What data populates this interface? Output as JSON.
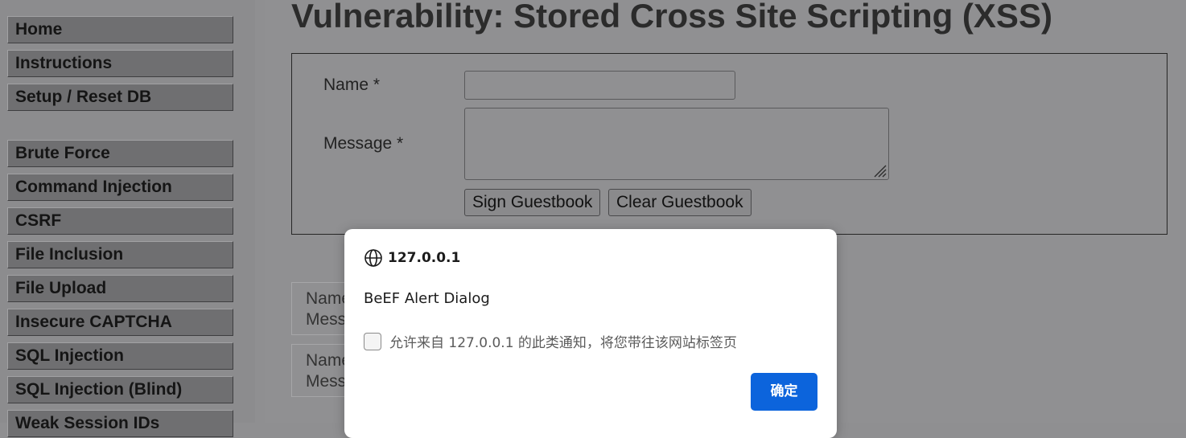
{
  "colors": {
    "backdrop": "#8f8f91",
    "menu_item_bg": "#6f6f71",
    "dialog_bg": "#ffffff",
    "primary_button": "#0c64dc"
  },
  "menu": {
    "items": [
      {
        "label": "Home"
      },
      {
        "label": "Instructions"
      },
      {
        "label": "Setup / Reset DB"
      },
      {
        "label": "Brute Force"
      },
      {
        "label": "Command Injection"
      },
      {
        "label": "CSRF"
      },
      {
        "label": "File Inclusion"
      },
      {
        "label": "File Upload"
      },
      {
        "label": "Insecure CAPTCHA"
      },
      {
        "label": "SQL Injection"
      },
      {
        "label": "SQL Injection (Blind)"
      },
      {
        "label": "Weak Session IDs"
      }
    ]
  },
  "main": {
    "title": "Vulnerability: Stored Cross Site Scripting (XSS)",
    "form": {
      "name_label": "Name *",
      "name_value": "",
      "message_label": "Message *",
      "message_value": "",
      "sign_button": "Sign Guestbook",
      "clear_button": "Clear Guestbook"
    },
    "entries": [
      {
        "name_label": "Name",
        "message_label": "Mess"
      },
      {
        "name_label": "Name",
        "message_label": "Mess"
      }
    ]
  },
  "dialog": {
    "icon": "globe-icon",
    "origin": "127.0.0.1",
    "message": "BeEF Alert Dialog",
    "checkbox_label": "允许来自 127.0.0.1 的此类通知，将您带往该网站标签页",
    "checkbox_checked": false,
    "ok_button": "确定"
  }
}
